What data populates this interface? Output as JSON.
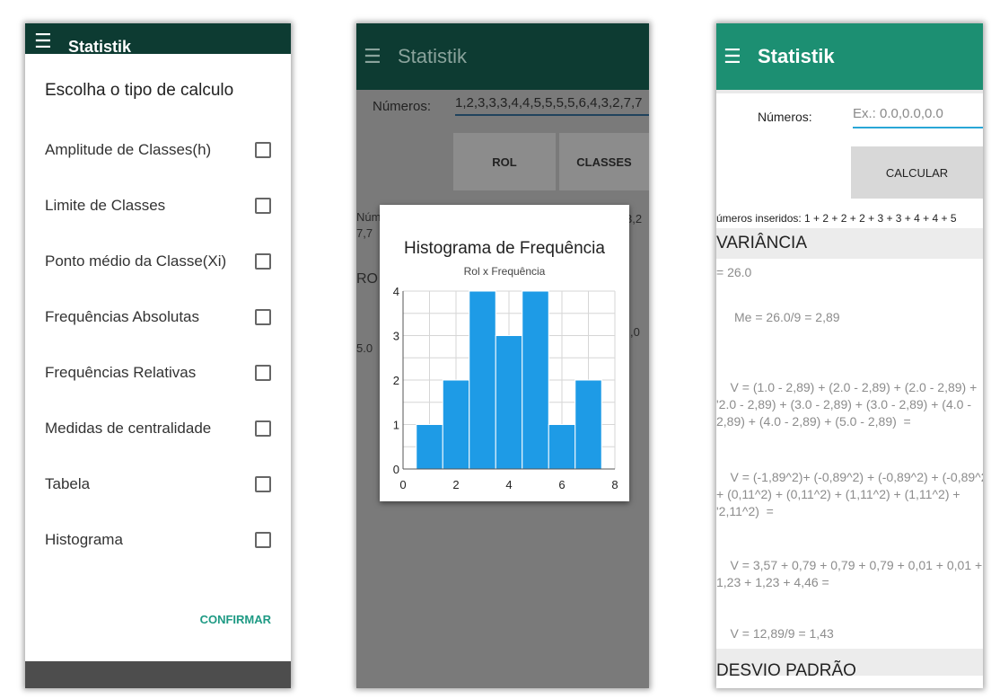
{
  "app": {
    "title": "Statistik"
  },
  "screen1": {
    "dialog_title": "Escolha o tipo de calculo",
    "options": [
      "Amplitude de Classes(h)",
      "Limite de Classes",
      "Ponto médio da Classe(Xi)",
      "Frequências Absolutas",
      "Frequências Relativas",
      "Medidas de centralidade",
      "Tabela",
      "Histograma"
    ],
    "confirm_label": "CONFIRMAR"
  },
  "screen2": {
    "numbers_label": "Números:",
    "numbers_value": "1,2,3,3,3,4,4,5,5,5,5,6,4,3,2,7,7",
    "rol_button": "ROL",
    "classes_button": "CLASSES",
    "chart_data": {
      "type": "bar",
      "title": "Histograma de Frequência",
      "subtitle": "Rol x Frequência",
      "bins": [
        {
          "x0": 0.5,
          "x1": 1.5,
          "value": 1
        },
        {
          "x0": 1.5,
          "x1": 2.5,
          "value": 2
        },
        {
          "x0": 2.5,
          "x1": 3.5,
          "value": 4
        },
        {
          "x0": 3.5,
          "x1": 4.5,
          "value": 3
        },
        {
          "x0": 4.5,
          "x1": 5.5,
          "value": 4
        },
        {
          "x0": 5.5,
          "x1": 6.5,
          "value": 1
        },
        {
          "x0": 6.5,
          "x1": 7.5,
          "value": 2
        }
      ],
      "xlim": [
        0,
        8
      ],
      "ylim": [
        0,
        4
      ],
      "xticks": [
        "0",
        "2",
        "4",
        "6",
        "8"
      ],
      "yticks": [
        "0",
        "1",
        "2",
        "3",
        "4"
      ],
      "grid": true,
      "bar_color": "#1e9be6"
    }
  },
  "screen3": {
    "numbers_label": "Números:",
    "numbers_placeholder": "Ex.: 0.0,0.0,0.0",
    "calc_button": "CALCULAR",
    "inserted": "úmeros inseridos: 1 + 2 + 2 + 2 + 3 + 3 + 4 + 4 + 5",
    "variance_heading": "VARIÂNCIA",
    "sum_line": "= 26.0",
    "mean_line": "Me = 26.0/9 = 2,89",
    "v_line1": "    V = (1.0 - 2,89) + (2.0 - 2,89) + (2.0 - 2,89) +\n'2.0 - 2,89) + (3.0 - 2,89) + (3.0 - 2,89) + (4.0 -\n2,89) + (4.0 - 2,89) + (5.0 - 2,89)  =",
    "v_line2": "    V = (-1,89^2)+ (-0,89^2) + (-0,89^2) + (-0,89^2)\n+ (0,11^2) + (0,11^2) + (1,11^2) + (1,11^2) +\n'2,11^2)  =",
    "v_line3": "    V = 3,57 + 0,79 + 0,79 + 0,79 + 0,01 + 0,01 +\n1,23 + 1,23 + 4,46 =",
    "v_result": "    V = 12,89/9 = 1,43",
    "stddev_heading": "DESVIO PADRÃO"
  }
}
